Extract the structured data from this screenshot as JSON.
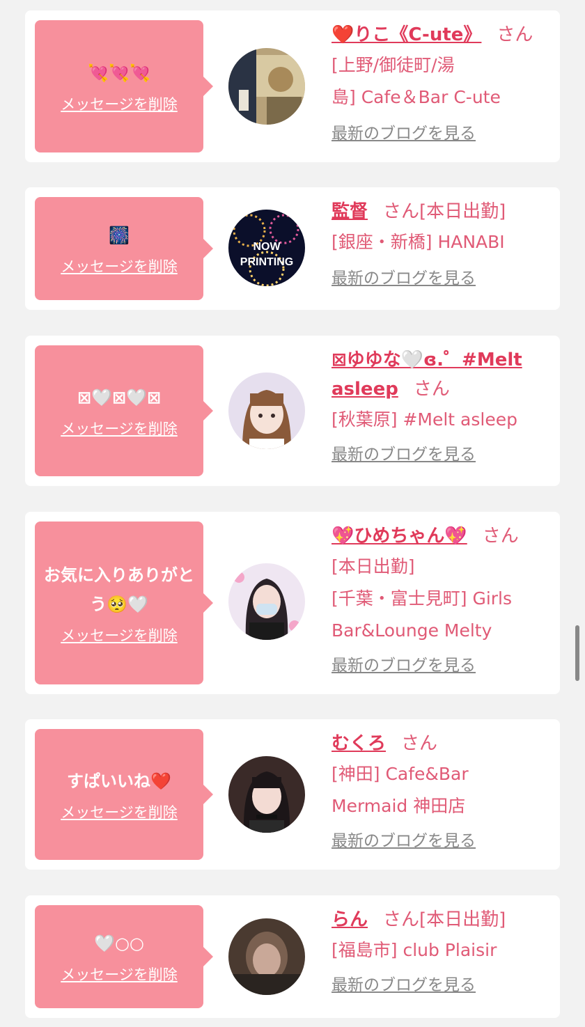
{
  "entries": [
    {
      "message": "💘💘💘",
      "delete_label": "メッセージを削除",
      "name": "❤️りこ《C-ute》",
      "san": "さん",
      "shop_lines": [
        "[上野/御徒町/湯",
        "島] Cafe＆Bar C-ute"
      ],
      "blog_label": "最新のブログを見る"
    },
    {
      "message": "🎆",
      "delete_label": "メッセージを削除",
      "name": "監督",
      "san": "さん[本日出勤]",
      "shop_lines": [
        "[銀座・新橋] HANABI"
      ],
      "blog_label": "最新のブログを見る",
      "avatar_text_1": "NOW",
      "avatar_text_2": "PRINTING"
    },
    {
      "message": "⊠🤍⊠🤍⊠",
      "delete_label": "メッセージを削除",
      "name": "⊠ゆゆな🤍ɞ.゜#Melt asleep",
      "san": "さん",
      "shop_lines": [
        "[秋葉原] #Melt asleep"
      ],
      "blog_label": "最新のブログを見る"
    },
    {
      "message": "お気に入りありがとう🥺🤍",
      "delete_label": "メッセージを削除",
      "name": "💖ひめちゃん💖",
      "san": "さん",
      "shop_lines": [
        "[本日出勤]",
        "[千葉・富士見町] Girls",
        "Bar&Lounge Melty"
      ],
      "blog_label": "最新のブログを見る"
    },
    {
      "message": "すぱいいね❤️",
      "delete_label": "メッセージを削除",
      "name": "むくろ",
      "san": "さん",
      "shop_lines": [
        "[神田] Cafe&Bar",
        "Mermaid 神田店"
      ],
      "blog_label": "最新のブログを見る"
    },
    {
      "message": "🤍○○",
      "delete_label": "メッセージを削除",
      "name": "らん",
      "san": "さん[本日出勤]",
      "shop_lines": [
        "[福島市] club Plaisir"
      ],
      "blog_label": "最新のブログを見る"
    }
  ],
  "colors": {
    "accent": "#f7909c",
    "name": "#e03a5a",
    "shop": "#e05a76",
    "link_gray": "#888888",
    "background": "#f2f2f2"
  }
}
